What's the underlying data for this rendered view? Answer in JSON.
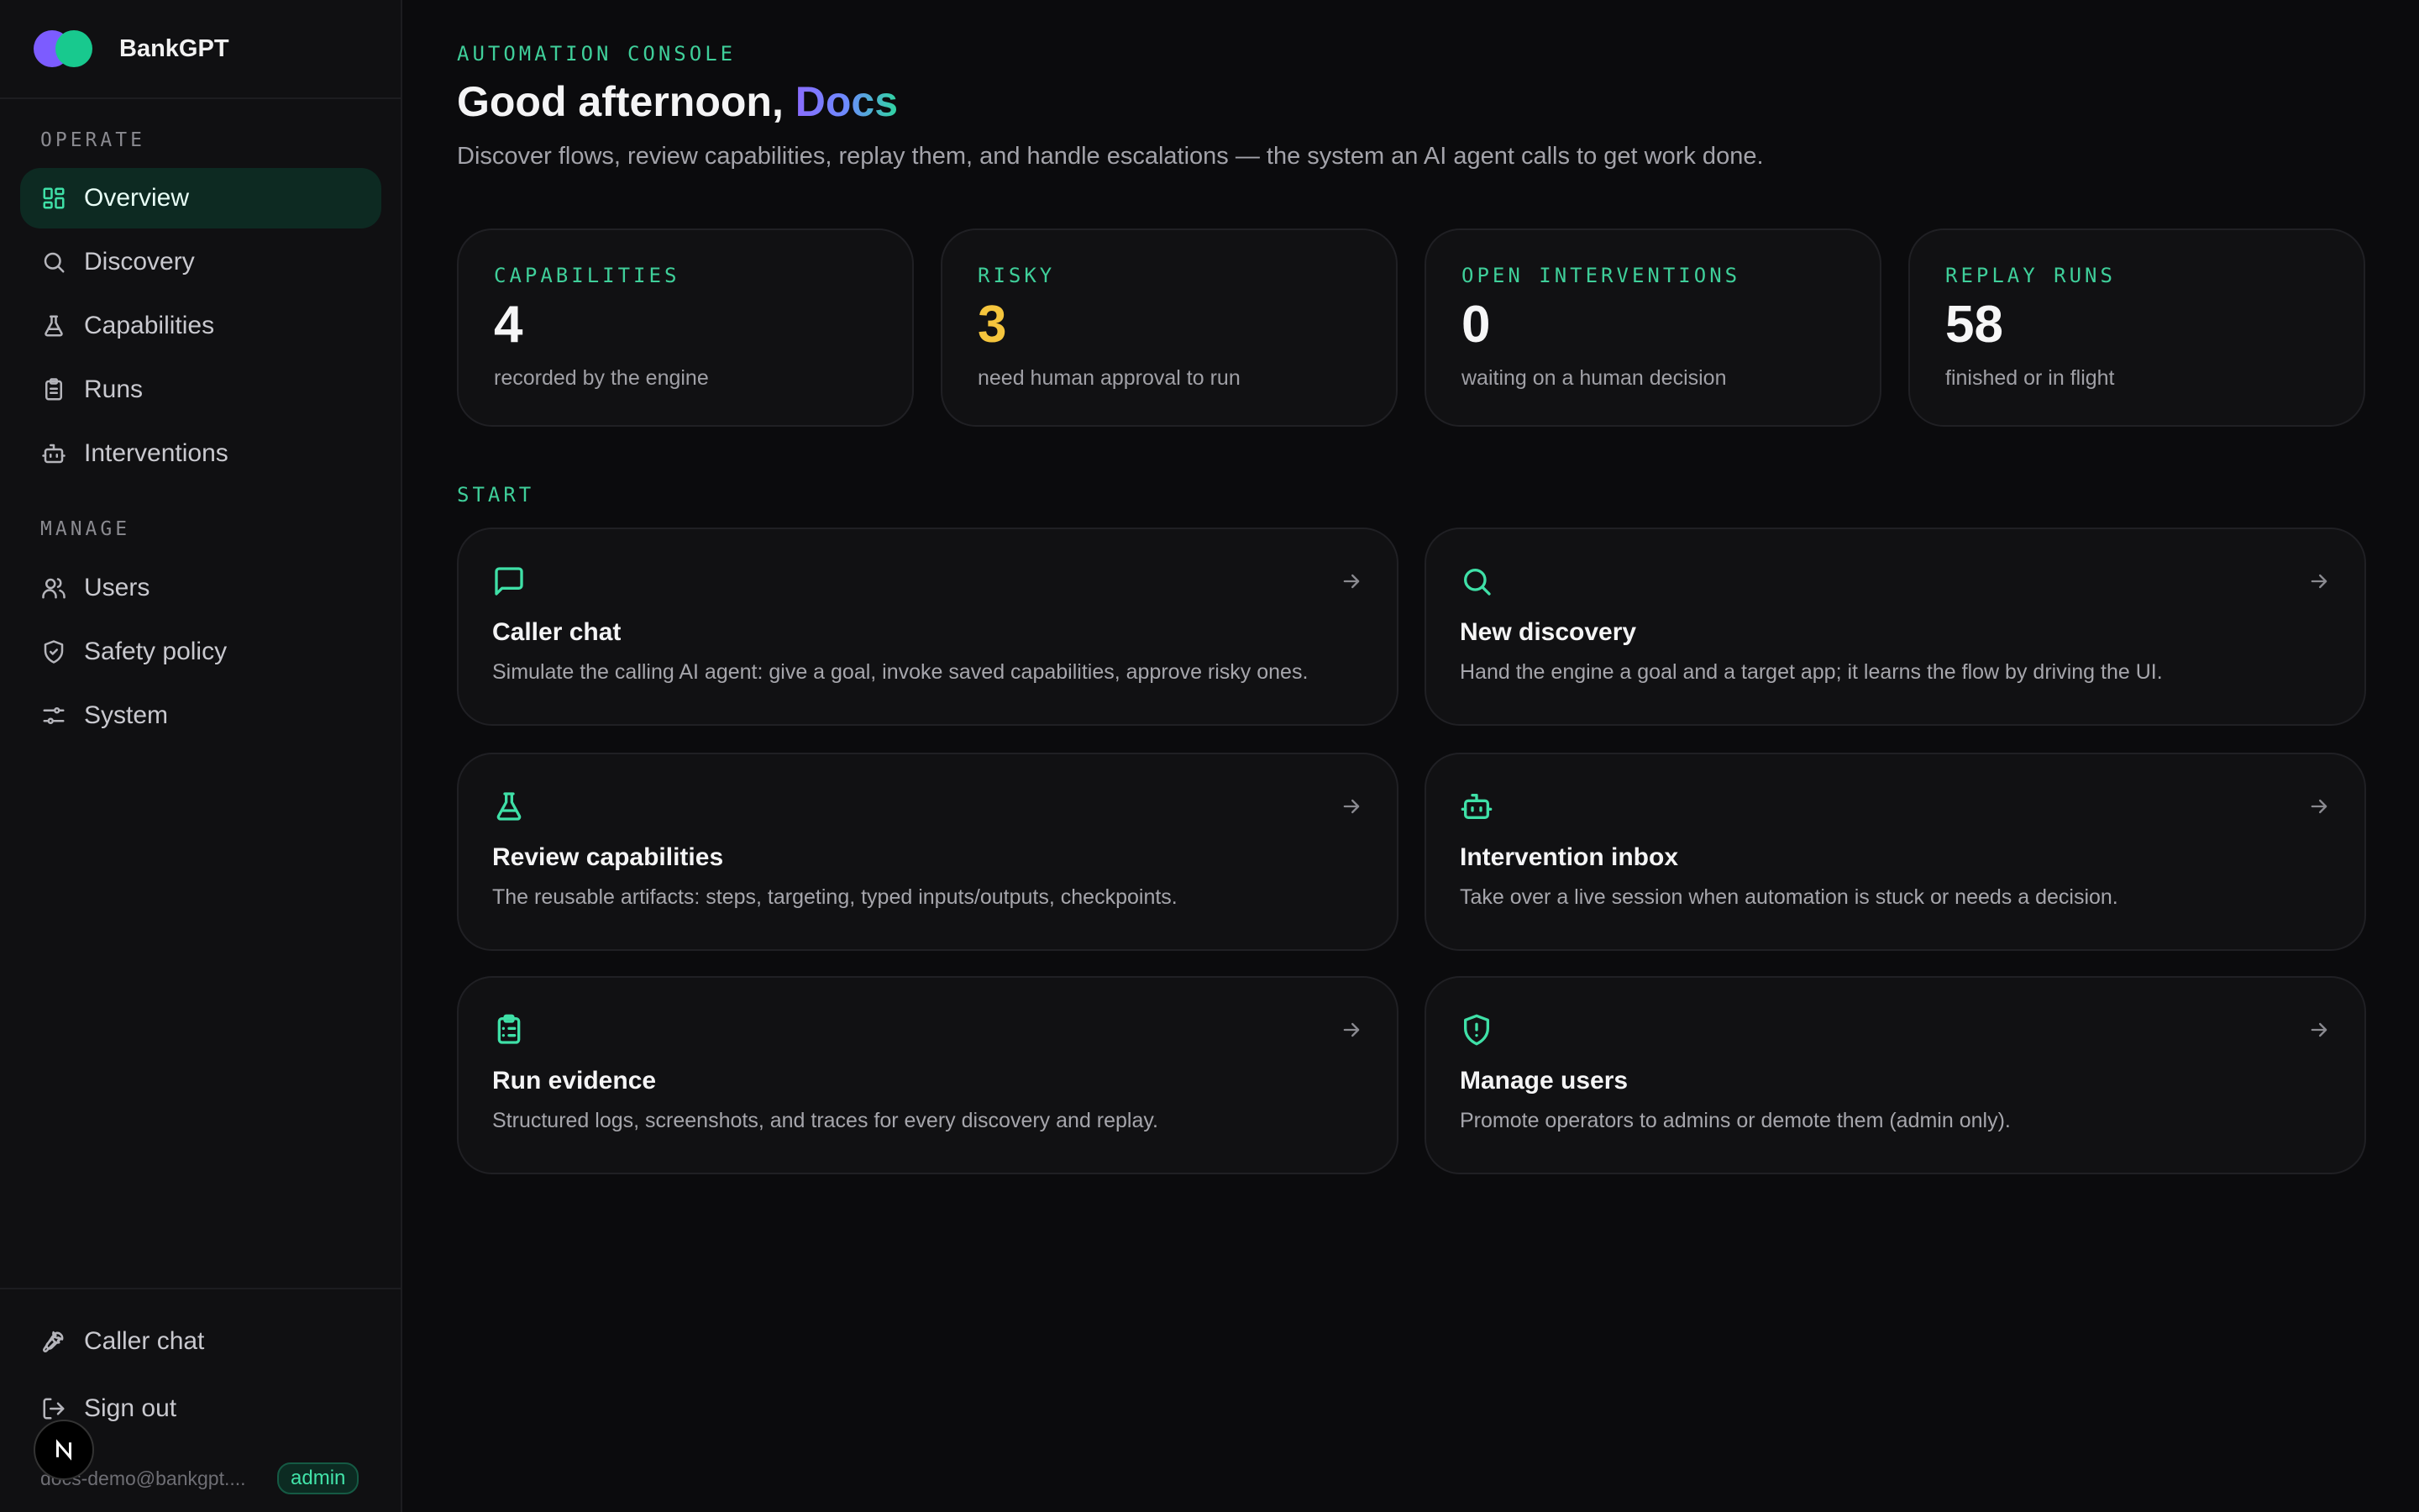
{
  "app": {
    "name": "BankGPT"
  },
  "sidebar": {
    "sections": [
      {
        "label": "OPERATE",
        "items": [
          {
            "label": "Overview",
            "icon": "dashboard-icon",
            "active": true
          },
          {
            "label": "Discovery",
            "icon": "search-icon"
          },
          {
            "label": "Capabilities",
            "icon": "flask-icon"
          },
          {
            "label": "Runs",
            "icon": "clipboard-icon"
          },
          {
            "label": "Interventions",
            "icon": "bot-icon"
          }
        ]
      },
      {
        "label": "MANAGE",
        "items": [
          {
            "label": "Users",
            "icon": "users-icon"
          },
          {
            "label": "Safety policy",
            "icon": "shield-check-icon"
          },
          {
            "label": "System",
            "icon": "sliders-icon"
          }
        ]
      }
    ],
    "footer": {
      "caller_chat": "Caller chat",
      "sign_out": "Sign out",
      "user_email": "docs-demo@bankgpt....",
      "role": "admin"
    }
  },
  "header": {
    "eyebrow": "AUTOMATION CONSOLE",
    "greeting": "Good afternoon, ",
    "user_name": "Docs",
    "subtitle": "Discover flows, review capabilities, replay them, and handle escalations — the system an AI agent calls to get work done."
  },
  "stats": [
    {
      "label": "CAPABILITIES",
      "value": "4",
      "desc": "recorded by the engine"
    },
    {
      "label": "RISKY",
      "value": "3",
      "desc": "need human approval to run",
      "color": "#f5c53d"
    },
    {
      "label": "OPEN INTERVENTIONS",
      "value": "0",
      "desc": "waiting on a human decision"
    },
    {
      "label": "REPLAY RUNS",
      "value": "58",
      "desc": "finished or in flight"
    }
  ],
  "start": {
    "label": "START",
    "cards": [
      {
        "title": "Caller chat",
        "desc": "Simulate the calling AI agent: give a goal, invoke saved capabilities, approve risky ones.",
        "icon": "chat-icon"
      },
      {
        "title": "New discovery",
        "desc": "Hand the engine a goal and a target app; it learns the flow by driving the UI.",
        "icon": "search-icon"
      },
      {
        "title": "Review capabilities",
        "desc": "The reusable artifacts: steps, targeting, typed inputs/outputs, checkpoints.",
        "icon": "flask-icon"
      },
      {
        "title": "Intervention inbox",
        "desc": "Take over a live session when automation is stuck or needs a decision.",
        "icon": "bot-icon"
      },
      {
        "title": "Run evidence",
        "desc": "Structured logs, screenshots, and traces for every discovery and replay.",
        "icon": "clipboard-icon"
      },
      {
        "title": "Manage users",
        "desc": "Promote operators to admins or demote them (admin only).",
        "icon": "shield-alert-icon"
      }
    ]
  },
  "colors": {
    "accent": "#3fe0a7",
    "warning": "#f5c53d",
    "background": "#0b0b0d"
  }
}
